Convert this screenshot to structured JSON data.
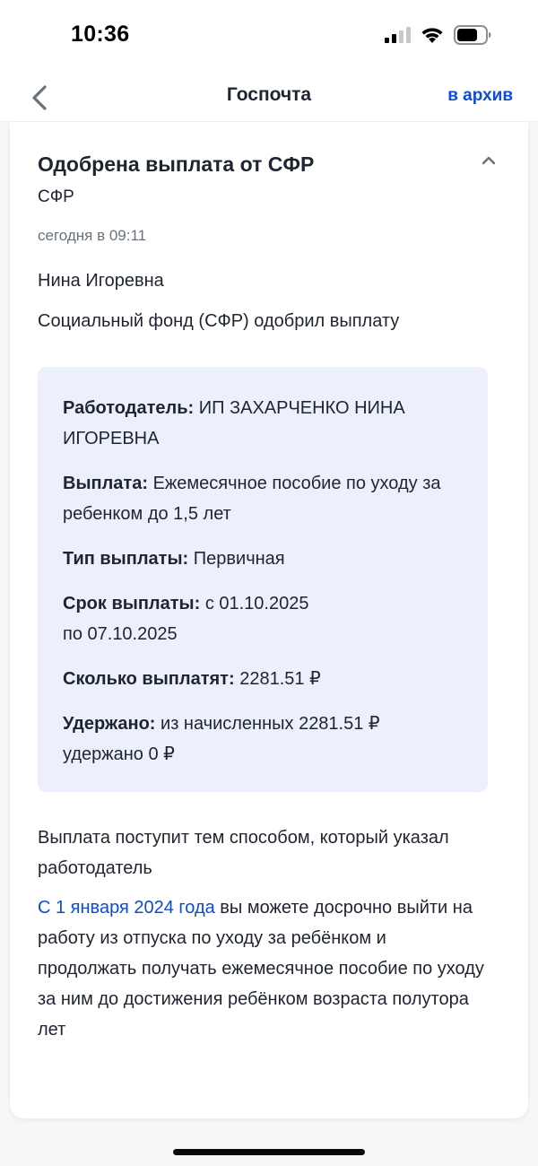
{
  "status_bar": {
    "time": "10:36",
    "icons": [
      "signal-icon",
      "wifi-icon",
      "battery-icon"
    ]
  },
  "nav": {
    "title": "Госпочта",
    "archive_label": "в архив",
    "back_icon": "chevron-left-icon"
  },
  "message": {
    "title": "Одобрена выплата от СФР",
    "sender": "СФР",
    "date": "сегодня в 09:11",
    "greeting": "Нина Игоревна",
    "intro": "Социальный фонд (СФР) одобрил выплату",
    "details": [
      {
        "label": "Работодатель:",
        "value": "ИП ЗАХАРЧЕНКО НИНА ИГОРЕВНА"
      },
      {
        "label": "Выплата:",
        "value": "Ежемесячное пособие по уходу за ребенком до 1,5 лет"
      },
      {
        "label": "Тип выплаты:",
        "value": "Первичная"
      },
      {
        "label": "Срок выплаты:",
        "value_line1": "с 01.10.2025",
        "value_line2": "по 07.10.2025"
      },
      {
        "label": "Сколько выплатят:",
        "value": "2281.51 ₽"
      },
      {
        "label": "Удержано:",
        "value_line1": "из начисленных 2281.51 ₽",
        "value_line2": "удержано 0 ₽"
      }
    ],
    "note": "Выплата поступит тем способом, который указал работодатель",
    "info_link": "С 1 января 2024 года",
    "info_text": " вы можете досрочно выйти на работу из отпуска по уходу за ребёнком и продолжать получать ежемесячное пособие по уходу за ним до достижения ребёнком возраста полутора лет"
  },
  "colors": {
    "accent": "#0d4cd3",
    "info_box_bg": "#ebf0fc",
    "text": "#1e2430",
    "secondary_text": "#66727f"
  }
}
